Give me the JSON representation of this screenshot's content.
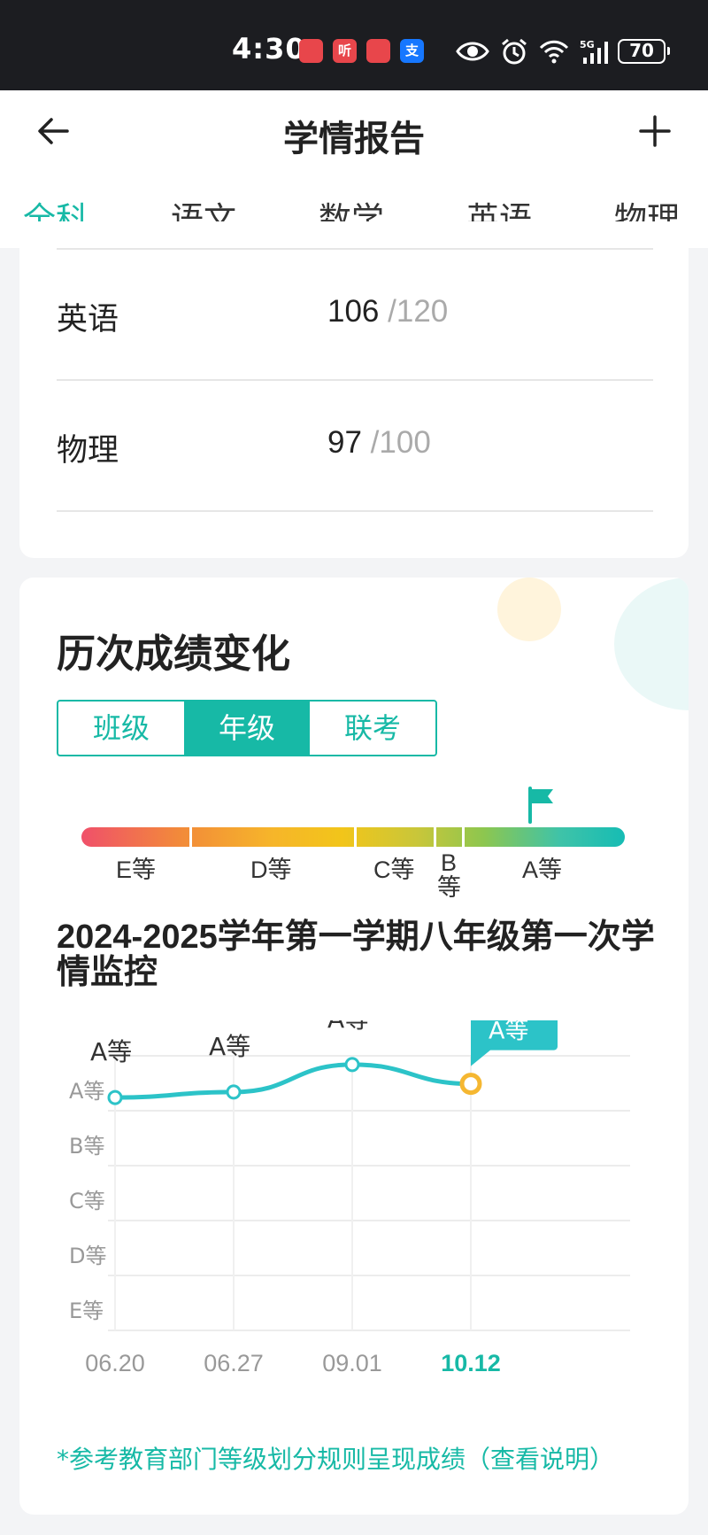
{
  "status_bar": {
    "time": "4:30",
    "apps": [
      {
        "icon": "huawei-store-icon",
        "glyph": "",
        "color": "#e8464b"
      },
      {
        "icon": "ting-icon",
        "glyph": "听",
        "color": "#e8464b"
      },
      {
        "icon": "huawei-store-icon",
        "glyph": "",
        "color": "#e8464b"
      },
      {
        "icon": "alipay-icon",
        "glyph": "支",
        "color": "#1677ff"
      }
    ],
    "battery": "70",
    "network": "5G"
  },
  "header": {
    "title": "学情报告"
  },
  "tabs": [
    {
      "label": "全科",
      "active": true
    },
    {
      "label": "语文",
      "active": false
    },
    {
      "label": "数学",
      "active": false
    },
    {
      "label": "英语",
      "active": false
    },
    {
      "label": "物理",
      "active": false
    }
  ],
  "scores": [
    {
      "subject": "英语",
      "score": "106",
      "total": "/120"
    },
    {
      "subject": "物理",
      "score": "97",
      "total": "/100"
    }
  ],
  "history": {
    "title": "历次成绩变化",
    "segments": [
      {
        "label": "班级",
        "active": false
      },
      {
        "label": "年级",
        "active": true
      },
      {
        "label": "联考",
        "active": false
      }
    ],
    "grade_scale": {
      "labels": [
        "E等",
        "D等",
        "C等",
        "B\n等",
        "A等"
      ],
      "current_marker": "A等"
    },
    "exam_title": "2024-2025学年第一学期八年级第一次学情监控",
    "footnote": "*参考教育部门等级划分规则呈现成绩（查看说明）"
  },
  "chart_data": {
    "type": "line",
    "x": [
      "06.20",
      "06.27",
      "09.01",
      "10.12"
    ],
    "y_categories": [
      "A等",
      "B等",
      "C等",
      "D等",
      "E等"
    ],
    "series": [
      {
        "values": [
          "A等",
          "A等",
          "A等",
          "A等"
        ],
        "level_position": [
          0.95,
          1.05,
          1.55,
          1.2
        ],
        "point_labels": [
          "A等",
          "A等",
          "A等",
          "A等"
        ]
      }
    ],
    "highlight_index": 3,
    "grid": true,
    "line_color": "#2cc3c8",
    "highlight_color": "#f5b731"
  },
  "colors": {
    "accent": "#17b9a6",
    "tab_active": "#17b9a6"
  }
}
